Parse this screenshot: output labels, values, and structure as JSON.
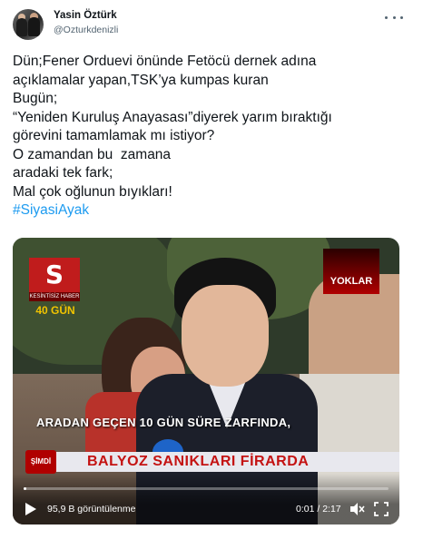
{
  "tweet": {
    "author": {
      "display_name": "Yasin Öztürk",
      "handle": "@Ozturkdenizli"
    },
    "text": "Dün;Fener Orduevi önünde Fetöcü dernek adına\naçıklamalar yapan,TSK’ya kumpas kuran\nBugün;\n“Yeniden Kuruluş Anayasası”diyerek yarım bıraktığı\ngörevini tamamlamak mı istiyor?\nO zamandan bu  zamana\naradaki tek fark;\nMal çok oğlunun bıyıkları!",
    "hashtag": "#SiyasiAyak"
  },
  "video": {
    "channel_logo": "S",
    "logo_subtext": "KESİNTİSİZ HABER",
    "badge": "40 GÜN",
    "corner_text": "YOKLAR",
    "subtitle": "ARADAN GEÇEN 10 GÜN SÜRE ZARFINDA,",
    "live_tag": "ŞİMDİ",
    "banner": "BALYOZ SANIKLARI FİRARDA",
    "progress": 0.008,
    "views": "95,9 B görüntülenme",
    "time": "0:01 / 2:17"
  },
  "icons": {
    "more": "more-horizontal-icon",
    "play": "play-icon",
    "mute": "speaker-muted-icon",
    "fullscreen": "fullscreen-icon"
  },
  "colors": {
    "hashtag": "#1d9bf0",
    "secondary_text": "#536471",
    "banner_text": "#c41212"
  }
}
